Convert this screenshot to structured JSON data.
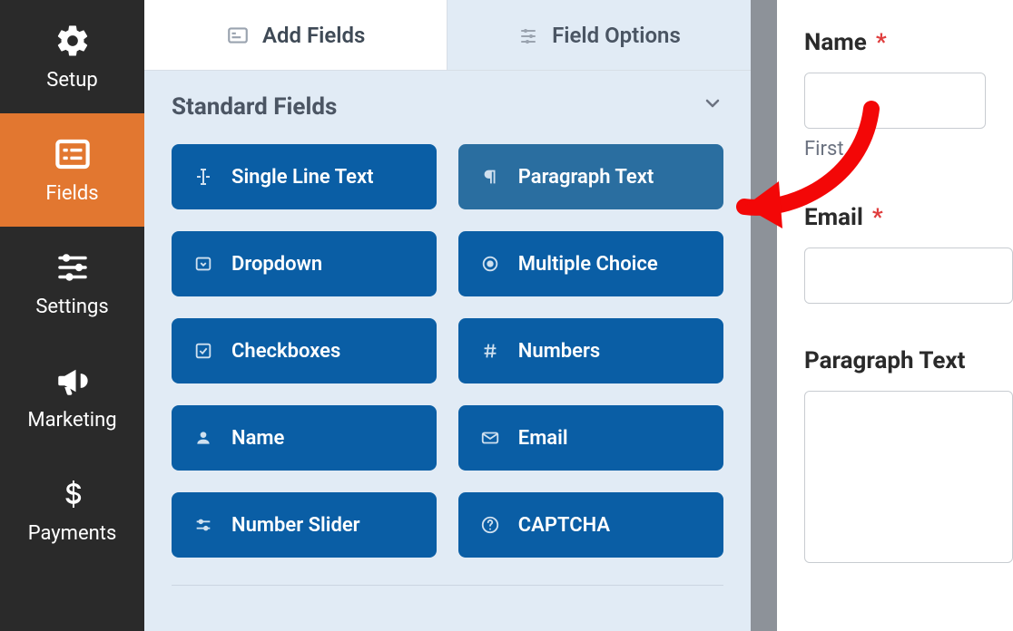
{
  "sidebar": {
    "items": [
      {
        "label": "Setup"
      },
      {
        "label": "Fields"
      },
      {
        "label": "Settings"
      },
      {
        "label": "Marketing"
      },
      {
        "label": "Payments"
      }
    ],
    "active_index": 1
  },
  "tabs": {
    "add_fields": "Add Fields",
    "field_options": "Field Options",
    "active": "add_fields"
  },
  "sections": {
    "standard_fields": {
      "title": "Standard Fields",
      "fields": [
        {
          "label": "Single Line Text"
        },
        {
          "label": "Paragraph Text"
        },
        {
          "label": "Dropdown"
        },
        {
          "label": "Multiple Choice"
        },
        {
          "label": "Checkboxes"
        },
        {
          "label": "Numbers"
        },
        {
          "label": "Name"
        },
        {
          "label": "Email"
        },
        {
          "label": "Number Slider"
        },
        {
          "label": "CAPTCHA"
        }
      ]
    }
  },
  "preview": {
    "name_label": "Name",
    "name_required": "*",
    "name_sublabel": "First",
    "email_label": "Email",
    "email_required": "*",
    "paragraph_label": "Paragraph Text"
  },
  "annotation": {
    "color": "#f30707"
  }
}
